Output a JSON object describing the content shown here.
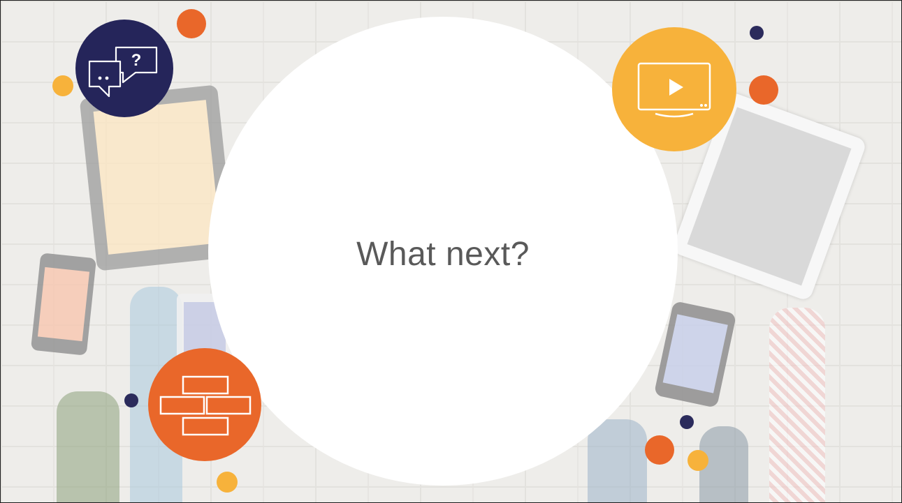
{
  "slide": {
    "title": "What next?"
  },
  "colors": {
    "navy": "#2b2b5c",
    "orange": "#e9672a",
    "amber": "#f7b23b",
    "text": "#595959"
  },
  "icons": {
    "top_left": "chat-question-icon",
    "top_right": "video-screen-icon",
    "bottom_left": "bricks-icon"
  }
}
